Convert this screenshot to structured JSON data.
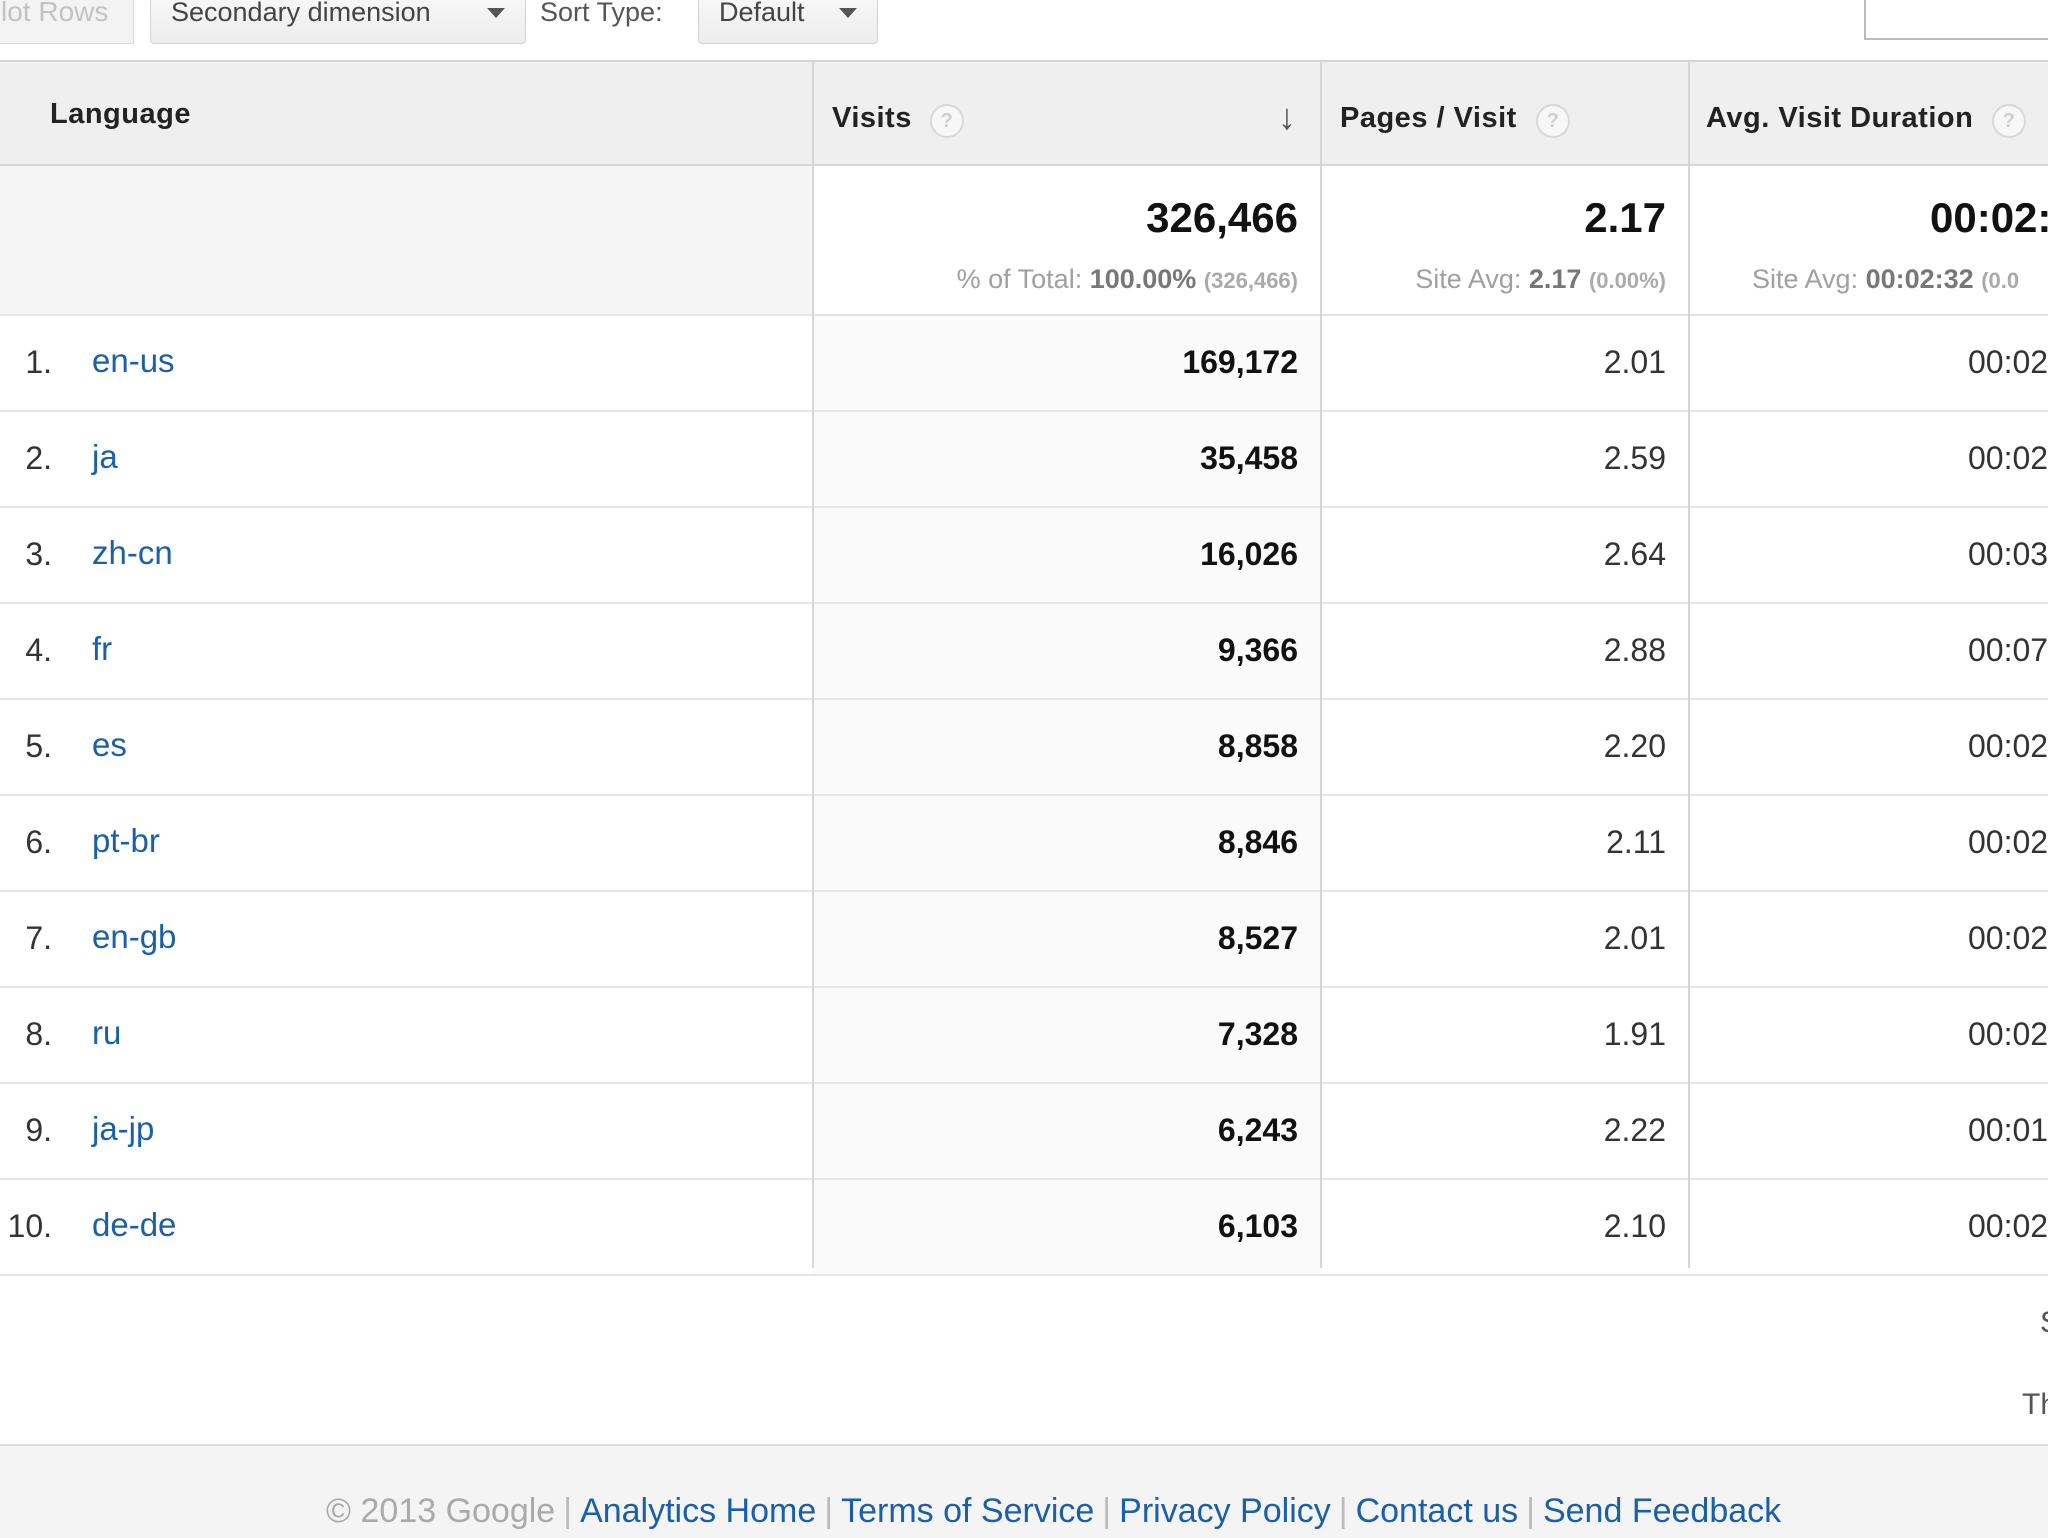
{
  "toolbar": {
    "plot_rows_label": "lot Rows",
    "secondary_dimension_label": "Secondary dimension",
    "sort_type_label": "Sort Type:",
    "sort_type_value": "Default"
  },
  "table": {
    "headers": {
      "language": "Language",
      "visits": "Visits",
      "pages_per_visit": "Pages / Visit",
      "avg_visit_duration": "Avg. Visit Duration",
      "help_glyph": "?",
      "sort_glyph": "↓"
    },
    "summary": {
      "visits_total": "326,466",
      "visits_pct_label": "% of Total: ",
      "visits_pct_value": "100.00%",
      "visits_pct_abs": "(326,466)",
      "ppv_total": "2.17",
      "ppv_site_label": "Site Avg: ",
      "ppv_site_value": "2.17",
      "ppv_site_delta": "(0.00%)",
      "dur_total": "00:02:",
      "dur_site_label": "Site Avg: ",
      "dur_site_value": "00:02:32",
      "dur_site_delta": "(0.0"
    },
    "rows": [
      {
        "idx": "1.",
        "lang": "en-us",
        "visits": "169,172",
        "ppv": "2.01",
        "dur": "00:02"
      },
      {
        "idx": "2.",
        "lang": "ja",
        "visits": "35,458",
        "ppv": "2.59",
        "dur": "00:02"
      },
      {
        "idx": "3.",
        "lang": "zh-cn",
        "visits": "16,026",
        "ppv": "2.64",
        "dur": "00:03"
      },
      {
        "idx": "4.",
        "lang": "fr",
        "visits": "9,366",
        "ppv": "2.88",
        "dur": "00:07"
      },
      {
        "idx": "5.",
        "lang": "es",
        "visits": "8,858",
        "ppv": "2.20",
        "dur": "00:02"
      },
      {
        "idx": "6.",
        "lang": "pt-br",
        "visits": "8,846",
        "ppv": "2.11",
        "dur": "00:02"
      },
      {
        "idx": "7.",
        "lang": "en-gb",
        "visits": "8,527",
        "ppv": "2.01",
        "dur": "00:02"
      },
      {
        "idx": "8.",
        "lang": "ru",
        "visits": "7,328",
        "ppv": "1.91",
        "dur": "00:02"
      },
      {
        "idx": "9.",
        "lang": "ja-jp",
        "visits": "6,243",
        "ppv": "2.22",
        "dur": "00:01"
      },
      {
        "idx": "10.",
        "lang": "de-de",
        "visits": "6,103",
        "ppv": "2.10",
        "dur": "00:02"
      }
    ]
  },
  "edge": {
    "glyph_1": "S",
    "glyph_2": "Th"
  },
  "footer": {
    "copyright": "© 2013 Google",
    "separator": "|",
    "links": [
      "Analytics Home",
      "Terms of Service",
      "Privacy Policy",
      "Contact us",
      "Send Feedback"
    ]
  },
  "colors": {
    "link": "#1a5fa8",
    "header_bg": "#efefef"
  }
}
